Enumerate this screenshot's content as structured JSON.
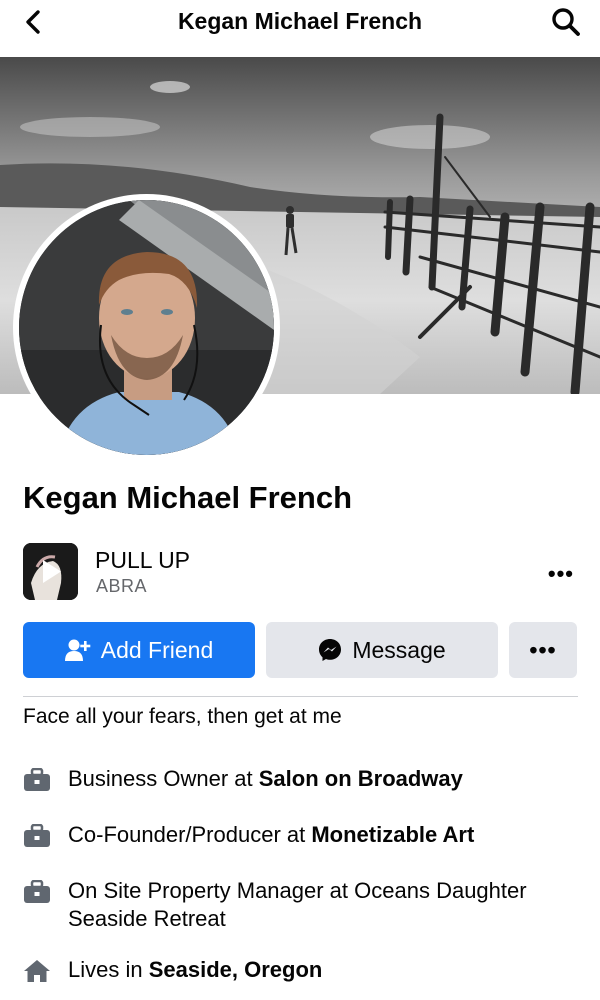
{
  "header": {
    "title": "Kegan Michael French",
    "back_icon": "chevron-left-icon",
    "search_icon": "search-icon"
  },
  "profile": {
    "name": "Kegan Michael French"
  },
  "music": {
    "song": "PULL UP",
    "artist": "ABRA",
    "play_icon": "play-icon",
    "more_label": "•••"
  },
  "actions": {
    "add_friend_label": "Add Friend",
    "message_label": "Message",
    "more_label": "•••"
  },
  "bio": "Face all your fears, then get at me",
  "details": [
    {
      "icon": "briefcase-icon",
      "prefix": "Business Owner at ",
      "bold": "Salon on Broadway"
    },
    {
      "icon": "briefcase-icon",
      "prefix": "Co-Founder/Producer at ",
      "bold": "Monetizable Art"
    },
    {
      "icon": "briefcase-icon",
      "prefix": "On Site Property Manager at Oceans Daughter Seaside Retreat",
      "bold": ""
    },
    {
      "icon": "home-icon",
      "prefix": "Lives in ",
      "bold": "Seaside, Oregon"
    }
  ],
  "colors": {
    "accent": "#1877f2",
    "button_secondary": "#e4e6eb",
    "text_secondary": "#65676b"
  }
}
